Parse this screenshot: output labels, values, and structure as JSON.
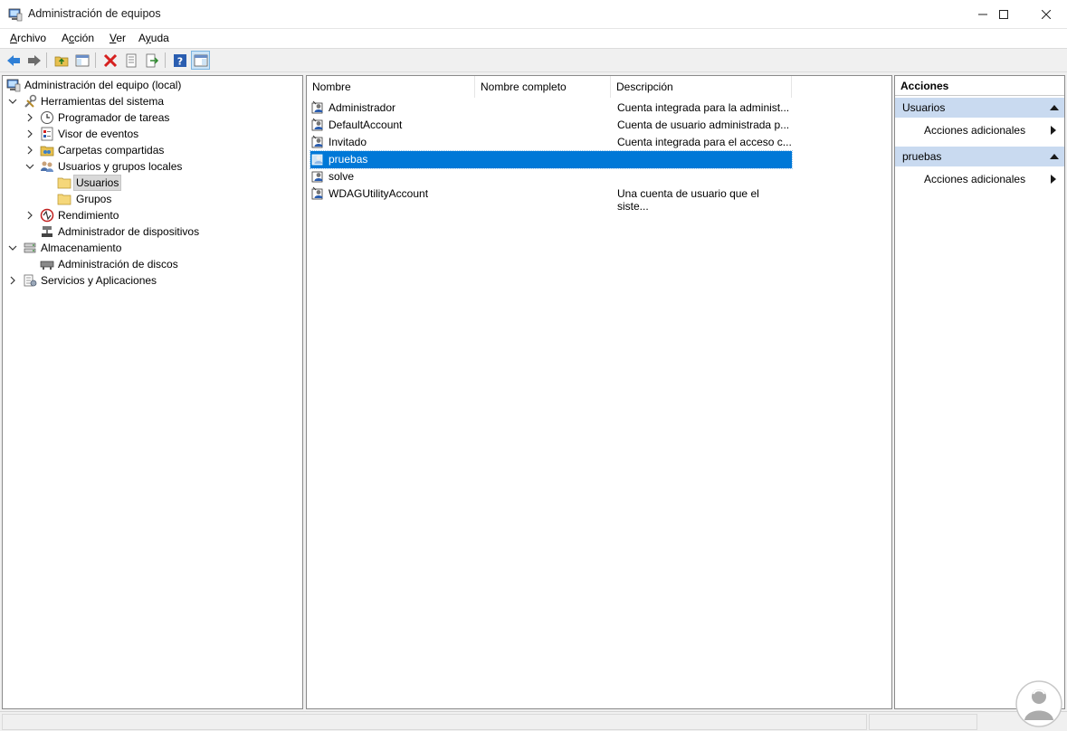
{
  "window": {
    "title": "Administración de equipos"
  },
  "menu": [
    {
      "label": "Archivo",
      "accel": "A"
    },
    {
      "label": "Acción",
      "accel": "c"
    },
    {
      "label": "Ver",
      "accel": "V"
    },
    {
      "label": "Ayuda",
      "accel": "y"
    }
  ],
  "tree": {
    "root": "Administración del equipo (local)",
    "items": [
      {
        "label": "Herramientas del sistema"
      },
      {
        "label": "Programador de tareas"
      },
      {
        "label": "Visor de eventos"
      },
      {
        "label": "Carpetas compartidas"
      },
      {
        "label": "Usuarios y grupos locales"
      },
      {
        "label": "Usuarios"
      },
      {
        "label": "Grupos"
      },
      {
        "label": "Rendimiento"
      },
      {
        "label": "Administrador de dispositivos"
      },
      {
        "label": "Almacenamiento"
      },
      {
        "label": "Administración de discos"
      },
      {
        "label": "Servicios y Aplicaciones"
      }
    ]
  },
  "list": {
    "headers": {
      "name": "Nombre",
      "full_name": "Nombre completo",
      "description": "Descripción"
    },
    "rows": [
      {
        "name": "Administrador",
        "full_name": "",
        "description": "Cuenta integrada para la administ..."
      },
      {
        "name": "DefaultAccount",
        "full_name": "",
        "description": "Cuenta de usuario administrada p..."
      },
      {
        "name": "Invitado",
        "full_name": "",
        "description": "Cuenta integrada para el acceso c..."
      },
      {
        "name": "pruebas",
        "full_name": "",
        "description": ""
      },
      {
        "name": "solve",
        "full_name": "",
        "description": ""
      },
      {
        "name": "WDAGUtilityAccount",
        "full_name": "",
        "description": "Una cuenta de usuario que el siste..."
      }
    ],
    "selected_row": "pruebas"
  },
  "actions": {
    "title": "Acciones",
    "groups": [
      {
        "label": "Usuarios",
        "item": "Acciones adicionales"
      },
      {
        "label": "pruebas",
        "item": "Acciones adicionales"
      }
    ]
  },
  "colors": {
    "selection": "#0078d7",
    "action_group_bg": "#c9daf0"
  }
}
